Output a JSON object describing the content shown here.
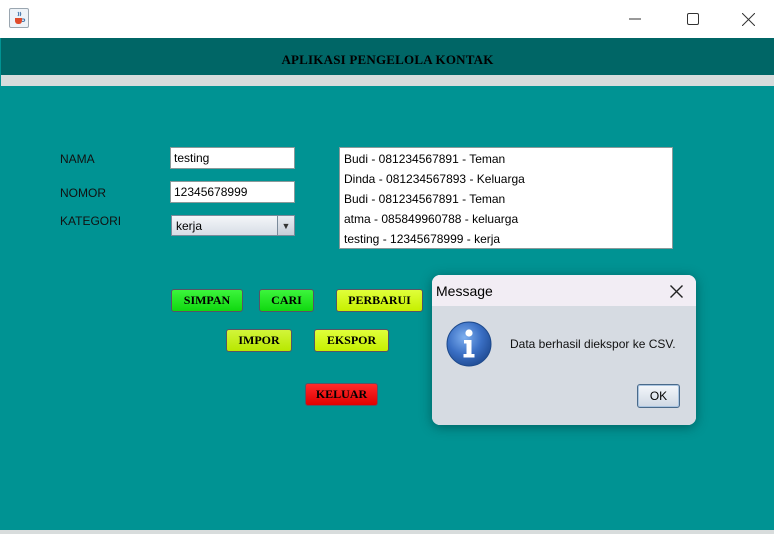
{
  "window": {
    "app_icon": "java-cup-icon",
    "controls": [
      "minimize-icon",
      "maximize-icon",
      "close-icon"
    ]
  },
  "header": {
    "title": "APLIKASI PENGELOLA KONTAK"
  },
  "form": {
    "nama_label": "NAMA",
    "nama_value": "testing",
    "nomor_label": "NOMOR",
    "nomor_value": "12345678999",
    "kategori_label": "KATEGORI",
    "kategori_value": "kerja"
  },
  "contacts": [
    "Budi - 081234567891 - Teman",
    "Dinda - 081234567893 - Keluarga",
    "Budi - 081234567891 - Teman",
    "atma - 085849960788 - keluarga",
    "testing - 12345678999 - kerja"
  ],
  "buttons": {
    "simpan": "SIMPAN",
    "cari": "CARI",
    "perbarui": "PERBARUI",
    "impor": "IMPOR",
    "ekspor": "EKSPOR",
    "keluar": "KELUAR"
  },
  "dialog": {
    "title": "Message",
    "message": "Data berhasil diekspor ke CSV.",
    "ok_label": "OK",
    "icon": "info-icon"
  },
  "colors": {
    "background": "#009393",
    "header": "#006666",
    "green_button": "#22e622",
    "lime_button": "#d4f81a",
    "red_button": "#f01010"
  }
}
